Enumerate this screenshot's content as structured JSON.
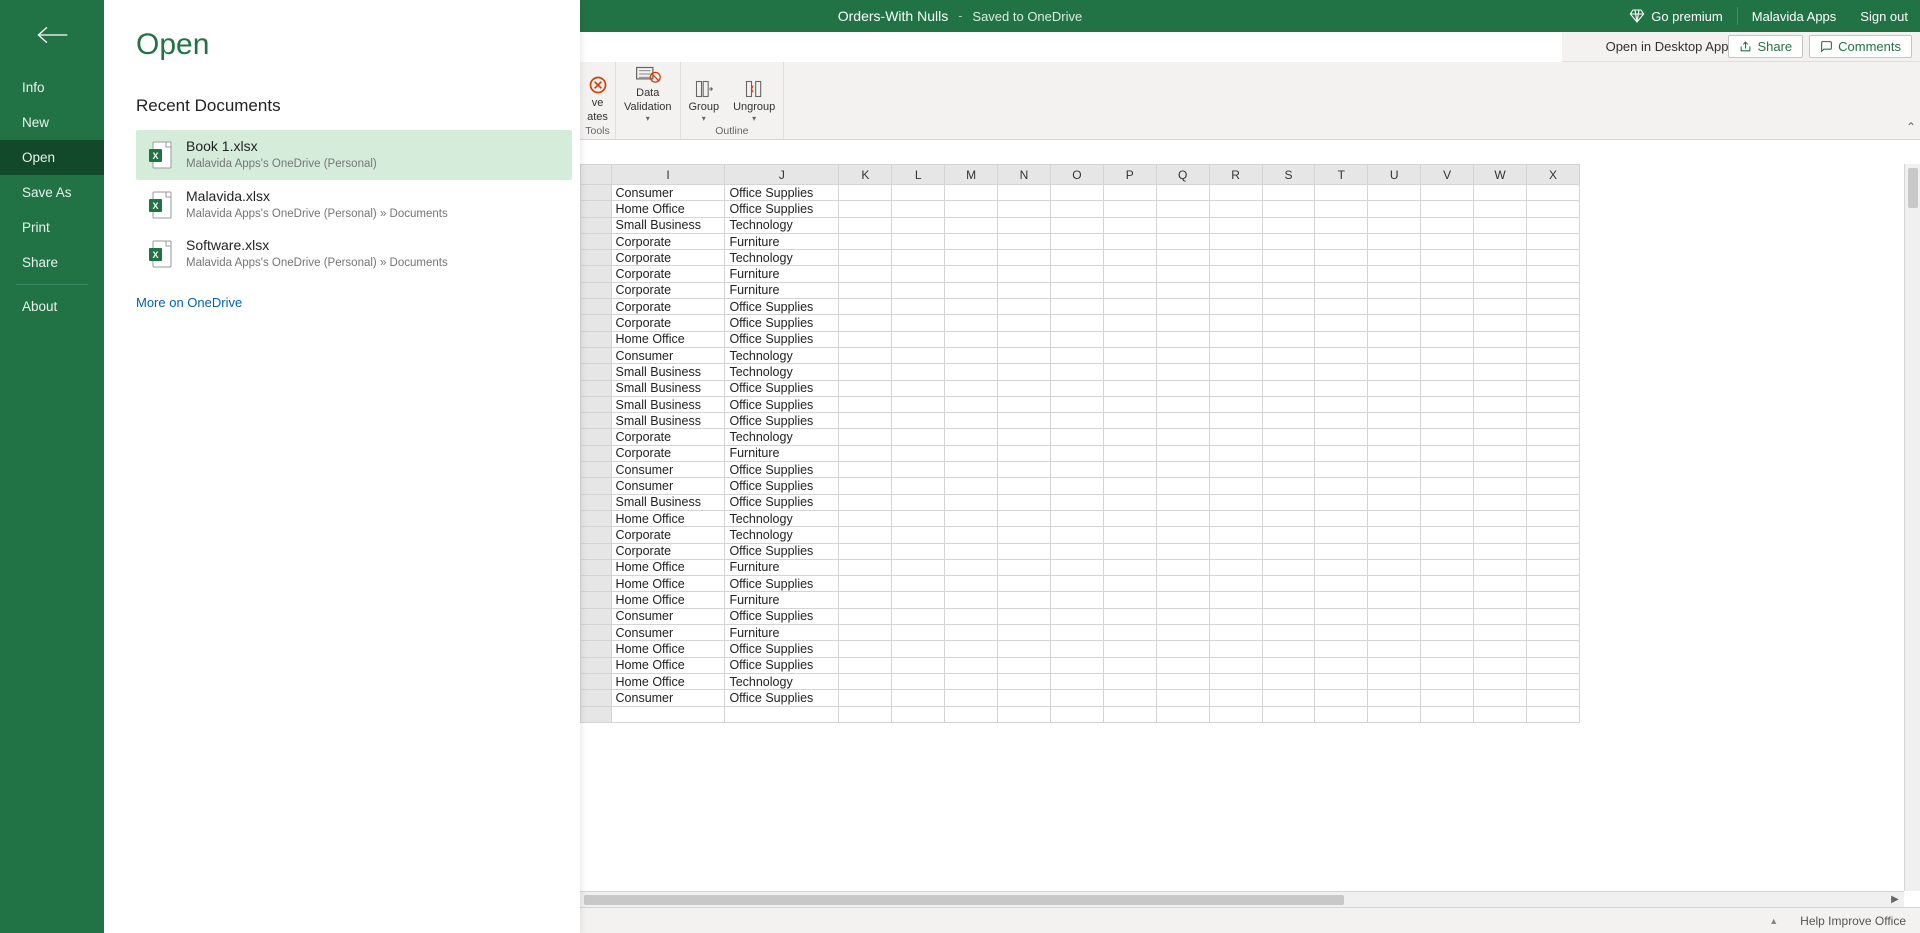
{
  "titlebar": {
    "doc_name": "Orders-With Nulls",
    "dash": "-",
    "saved_status": "Saved to OneDrive",
    "go_premium": "Go premium",
    "user_name": "Malavida Apps",
    "sign_out": "Sign out"
  },
  "ribbon": {
    "open_desktop": "Open in Desktop App",
    "share": "Share",
    "comments": "Comments",
    "data_validation_top": "Data",
    "data_validation_bottom": "Validation",
    "group": "Group",
    "ungroup": "Ungroup",
    "tools_label": "Tools",
    "outline_label": "Outline",
    "partial_ve": "ve",
    "partial_ates": "ates"
  },
  "statusbar": {
    "help_improve": "Help Improve Office"
  },
  "backstage": {
    "title": "Open",
    "nav": {
      "info": "Info",
      "new": "New",
      "open": "Open",
      "save_as": "Save As",
      "print": "Print",
      "share": "Share",
      "about": "About"
    },
    "section_title": "Recent Documents",
    "more_link": "More on OneDrive",
    "docs": [
      {
        "name": "Book 1.xlsx",
        "path": "Malavida Apps's OneDrive (Personal)",
        "selected": true
      },
      {
        "name": "Malavida.xlsx",
        "path": "Malavida Apps's OneDrive (Personal) » Documents",
        "selected": false
      },
      {
        "name": "Software.xlsx",
        "path": "Malavida Apps's OneDrive (Personal) » Documents",
        "selected": false
      }
    ]
  },
  "grid": {
    "columns": [
      "I",
      "J",
      "K",
      "L",
      "M",
      "N",
      "O",
      "P",
      "Q",
      "R",
      "S",
      "T",
      "U",
      "V",
      "W",
      "X"
    ],
    "rows": [
      {
        "i": "Consumer",
        "j": "Office Supplies"
      },
      {
        "i": "Home Office",
        "j": "Office Supplies"
      },
      {
        "i": "Small Business",
        "j": "Technology"
      },
      {
        "i": "Corporate",
        "j": "Furniture"
      },
      {
        "i": "Corporate",
        "j": "Technology"
      },
      {
        "i": "Corporate",
        "j": "Furniture"
      },
      {
        "i": "Corporate",
        "j": "Furniture"
      },
      {
        "i": "Corporate",
        "j": "Office Supplies"
      },
      {
        "i": "Corporate",
        "j": "Office Supplies"
      },
      {
        "i": "Home Office",
        "j": "Office Supplies"
      },
      {
        "i": "Consumer",
        "j": "Technology"
      },
      {
        "i": "Small Business",
        "j": "Technology"
      },
      {
        "i": "Small Business",
        "j": "Office Supplies"
      },
      {
        "i": "Small Business",
        "j": "Office Supplies"
      },
      {
        "i": "Small Business",
        "j": "Office Supplies"
      },
      {
        "i": "Corporate",
        "j": "Technology"
      },
      {
        "i": "Corporate",
        "j": "Furniture"
      },
      {
        "i": "Consumer",
        "j": "Office Supplies"
      },
      {
        "i": "Consumer",
        "j": "Office Supplies"
      },
      {
        "i": "Small Business",
        "j": "Office Supplies"
      },
      {
        "i": "Home Office",
        "j": "Technology"
      },
      {
        "i": "Corporate",
        "j": "Technology"
      },
      {
        "i": "Corporate",
        "j": "Office Supplies"
      },
      {
        "i": "Home Office",
        "j": "Furniture"
      },
      {
        "i": "Home Office",
        "j": "Office Supplies"
      },
      {
        "i": "Home Office",
        "j": "Furniture"
      },
      {
        "i": "Consumer",
        "j": "Office Supplies"
      },
      {
        "i": "Consumer",
        "j": "Furniture"
      },
      {
        "i": "Home Office",
        "j": "Office Supplies"
      },
      {
        "i": "Home Office",
        "j": "Office Supplies"
      },
      {
        "i": "Home Office",
        "j": "Technology"
      },
      {
        "i": "Consumer",
        "j": "Office Supplies"
      }
    ]
  }
}
